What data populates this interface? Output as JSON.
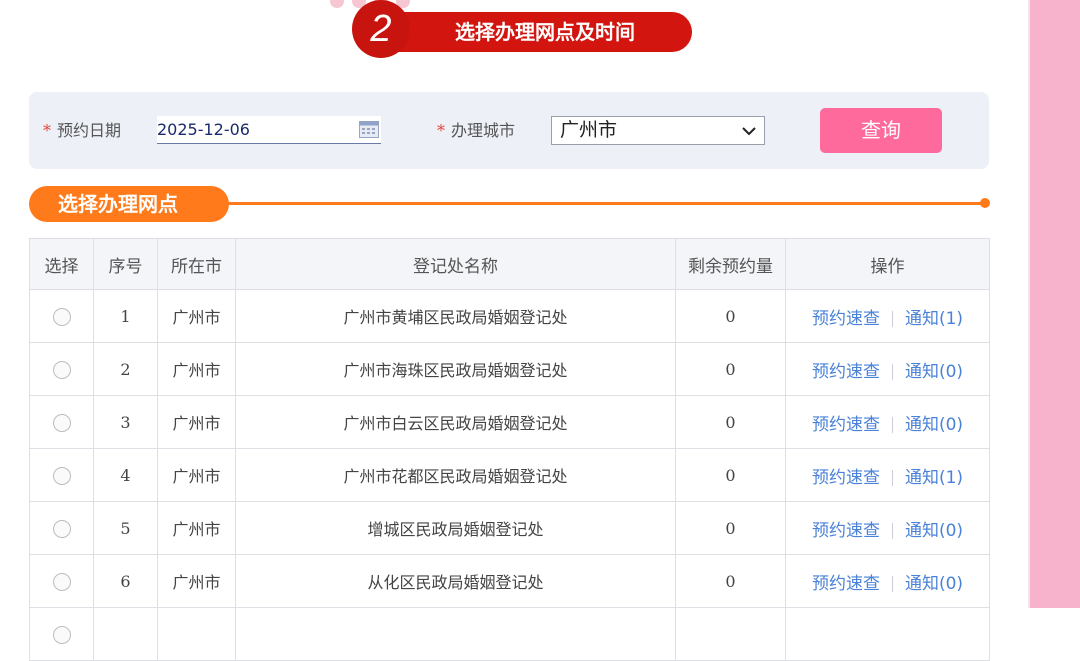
{
  "step": {
    "number": "2",
    "title": "选择办理网点及时间"
  },
  "query": {
    "date_label": "预约日期",
    "date_value": "2025-12-06",
    "city_label": "办理城市",
    "city_value": "广州市",
    "search_button": "查询",
    "required_mark": "*"
  },
  "section": {
    "title": "选择办理网点"
  },
  "table": {
    "headers": [
      "选择",
      "序号",
      "所在市",
      "登记处名称",
      "剩余预约量",
      "操作"
    ],
    "rows": [
      {
        "index": "1",
        "city": "广州市",
        "name": "广州市黄埔区民政局婚姻登记处",
        "remain": "0",
        "op1": "预约速查",
        "op2": "通知(1)"
      },
      {
        "index": "2",
        "city": "广州市",
        "name": "广州市海珠区民政局婚姻登记处",
        "remain": "0",
        "op1": "预约速查",
        "op2": "通知(0)"
      },
      {
        "index": "3",
        "city": "广州市",
        "name": "广州市白云区民政局婚姻登记处",
        "remain": "0",
        "op1": "预约速查",
        "op2": "通知(0)"
      },
      {
        "index": "4",
        "city": "广州市",
        "name": "广州市花都区民政局婚姻登记处",
        "remain": "0",
        "op1": "预约速查",
        "op2": "通知(1)"
      },
      {
        "index": "5",
        "city": "广州市",
        "name": "增城区民政局婚姻登记处",
        "remain": "0",
        "op1": "预约速查",
        "op2": "通知(0)"
      },
      {
        "index": "6",
        "city": "广州市",
        "name": "从化区民政局婚姻登记处",
        "remain": "0",
        "op1": "预约速查",
        "op2": "通知(0)"
      }
    ]
  },
  "colors": {
    "step_red": "#d2150f",
    "accent_orange": "#ff7a1a",
    "button_pink": "#ff6a9c",
    "link_blue": "#4a82d8",
    "side_pink": "#f7b3cc"
  },
  "icons": [
    "calendar-icon",
    "chevron-down-icon",
    "radio-icon"
  ]
}
